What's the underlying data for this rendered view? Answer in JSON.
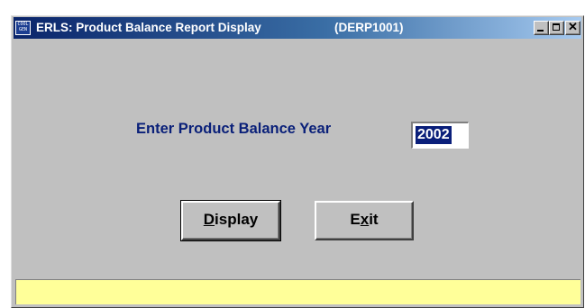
{
  "window": {
    "title": "ERLS: Product Balance Report Display",
    "code": "(DERP1001)",
    "icon": "cool-gen-app-icon",
    "icon_text": "COOL GEN",
    "controls": {
      "minimize": "minimize-icon",
      "maximize": "maximize-icon",
      "close": "close-icon"
    }
  },
  "form": {
    "year_label": "Enter Product Balance Year",
    "year_value": "2002"
  },
  "buttons": {
    "display_pre": "",
    "display_mnemonic": "D",
    "display_post": "isplay",
    "exit_pre": "E",
    "exit_mnemonic": "x",
    "exit_post": "it"
  },
  "status_bar": {
    "text": ""
  },
  "colors": {
    "title_bar_start": "#0a246a",
    "title_bar_end": "#a6caf0",
    "label": "#0a2079",
    "selection": "#0a1f7a",
    "status_bar": "#ffff99",
    "face": "#c0c0c0"
  }
}
